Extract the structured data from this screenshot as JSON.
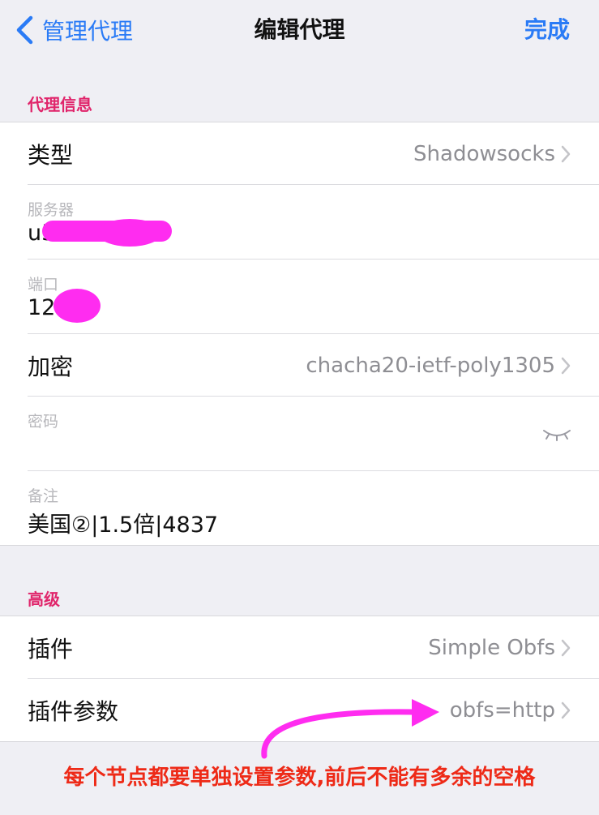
{
  "nav": {
    "back_label": "管理代理",
    "title": "编辑代理",
    "done_label": "完成"
  },
  "sections": {
    "proxy_info": "代理信息",
    "advanced": "高级"
  },
  "proxy_info": {
    "type_label": "类型",
    "type_value": "Shadowsocks",
    "server_label": "服务器",
    "server_value": "u5 m",
    "port_label": "端口",
    "port_value": "120",
    "encryption_label": "加密",
    "encryption_value": "chacha20-ietf-poly1305",
    "password_label": "密码",
    "note_label": "备注",
    "note_value": "美国②|1.5倍|4837"
  },
  "advanced": {
    "plugin_label": "插件",
    "plugin_value": "Simple Obfs",
    "plugin_params_label": "插件参数",
    "plugin_params_value": "obfs=http"
  },
  "annotation": "每个节点都要单独设置参数,前后不能有多余的空格",
  "icons": {
    "back": "chevron-left-icon",
    "disclosure": "chevron-right-icon",
    "password_toggle": "eye-closed-icon"
  },
  "colors": {
    "accent_blue": "#2a7bf6",
    "section_header": "#e0256b",
    "annotation_red": "#ee2a17",
    "redaction_magenta": "#ff2cf0"
  }
}
